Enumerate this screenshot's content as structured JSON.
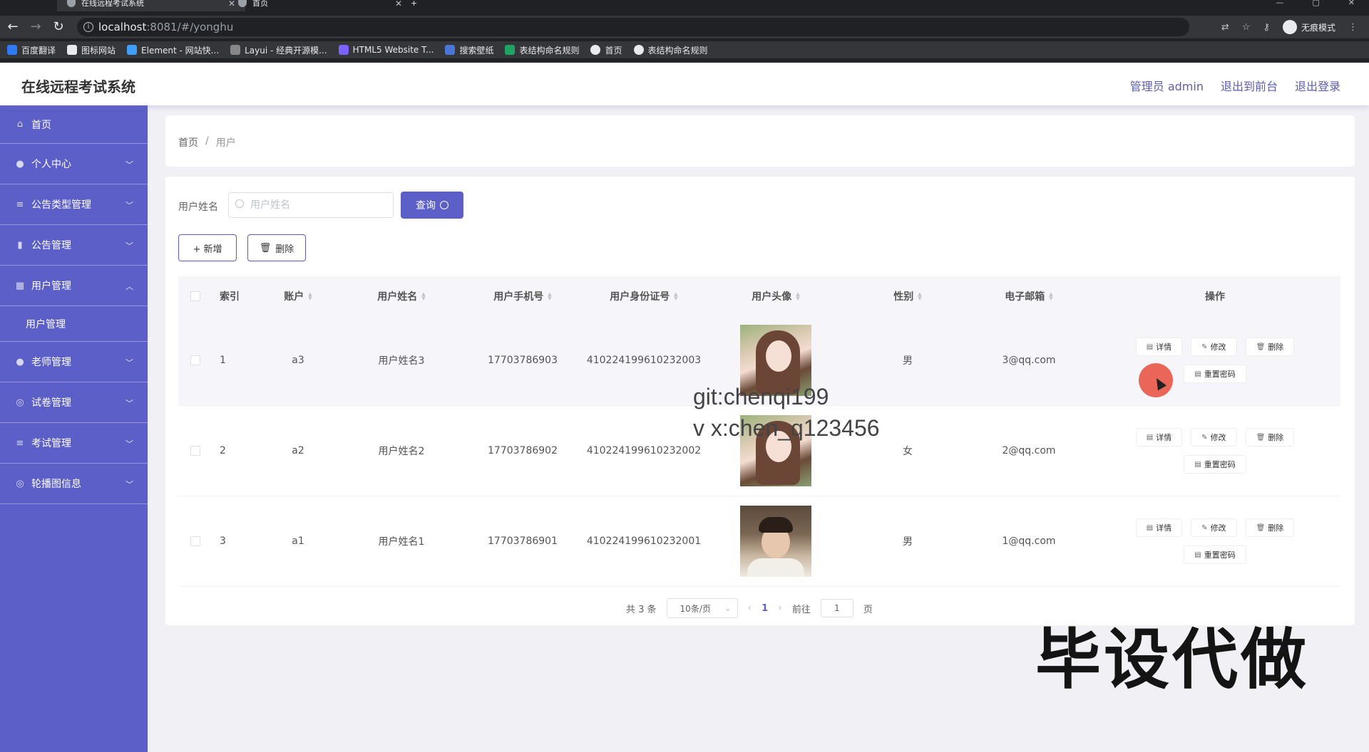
{
  "browser": {
    "tabs": [
      {
        "label": "在线远程考试系统",
        "active": true
      },
      {
        "label": "首页",
        "active": false
      }
    ],
    "new_tab": "+",
    "url_host": "localhost",
    "url_path": ":8081/#/yonghu",
    "incognito_label": "无痕模式",
    "bookmarks": [
      "百度翻译",
      "图标网站",
      "Element - 网站快...",
      "Layui - 经典开源模...",
      "HTML5 Website T...",
      "搜索壁纸",
      "表结构命名规则",
      "首页",
      "表结构命名规则"
    ]
  },
  "header": {
    "title": "在线远程考试系统",
    "admin": "管理员 admin",
    "to_front": "退出到前台",
    "logout": "退出登录"
  },
  "sidebar": {
    "items": [
      {
        "label": "首页",
        "icon": "home-icon"
      },
      {
        "label": "个人中心",
        "icon": "user-icon"
      },
      {
        "label": "公告类型管理",
        "icon": "list-icon"
      },
      {
        "label": "公告管理",
        "icon": "chart-icon"
      },
      {
        "label": "用户管理",
        "icon": "grid-icon"
      },
      {
        "label": "用户管理",
        "icon": ""
      },
      {
        "label": "老师管理",
        "icon": "user-icon"
      },
      {
        "label": "试卷管理",
        "icon": "circle-icon"
      },
      {
        "label": "考试管理",
        "icon": "list-icon"
      },
      {
        "label": "轮播图信息",
        "icon": "circle-icon"
      }
    ]
  },
  "breadcrumb": {
    "home": "首页",
    "sep": "/",
    "current": "用户"
  },
  "search": {
    "label": "用户姓名",
    "placeholder": "用户姓名",
    "query_label": "查询"
  },
  "actions": {
    "add_label": "+ 新增",
    "delete_label": "删除"
  },
  "table": {
    "headers": [
      "索引",
      "账户",
      "用户姓名",
      "用户手机号",
      "用户身份证号",
      "用户头像",
      "性别",
      "电子邮箱",
      "操作"
    ],
    "rows": [
      {
        "index": "1",
        "account": "a3",
        "name": "用户姓名3",
        "phone": "17703786903",
        "id_card": "410224199610232003",
        "gender": "男",
        "email": "3@qq.com"
      },
      {
        "index": "2",
        "account": "a2",
        "name": "用户姓名2",
        "phone": "17703786902",
        "id_card": "410224199610232002",
        "gender": "女",
        "email": "2@qq.com"
      },
      {
        "index": "3",
        "account": "a1",
        "name": "用户姓名1",
        "phone": "17703786901",
        "id_card": "410224199610232001",
        "gender": "男",
        "email": "1@qq.com"
      }
    ],
    "op_detail": "详情",
    "op_edit": "修改",
    "op_delete": "删除",
    "op_reset": "重置密码"
  },
  "pagination": {
    "total": "共 3 条",
    "page_size": "10条/页",
    "current_page": "1",
    "goto_label": "前往",
    "goto_value": "1",
    "page_suffix": "页"
  },
  "overlay": {
    "watermark_line1": "git:chenqi199",
    "watermark_line2": "v x:chen_q123456",
    "promo": "毕设代做"
  },
  "colors": {
    "accent": "#5c5fc7",
    "header_text": "#5c5db0"
  }
}
